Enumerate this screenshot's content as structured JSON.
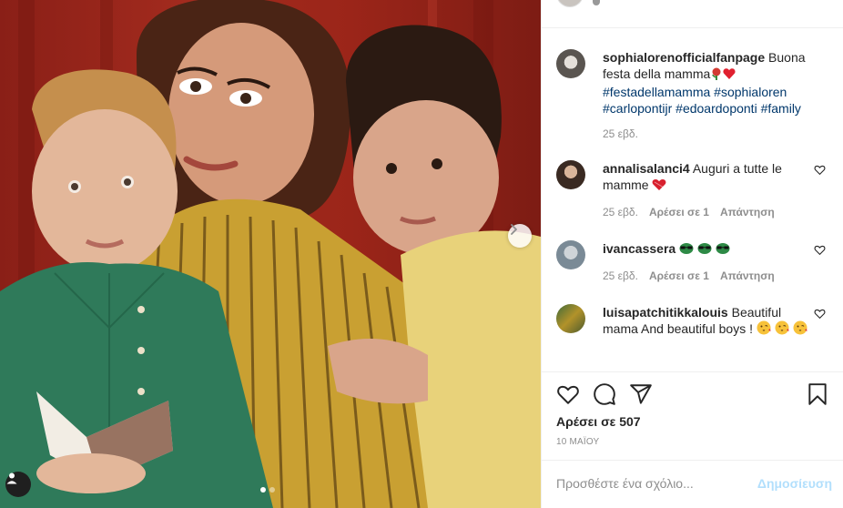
{
  "post": {
    "author": "sophialorenofficialfanpage",
    "caption_text": "Buona festa della mamma",
    "hashtags": [
      "#festadellamamma",
      "#sophialoren",
      "#carloponti jr",
      "#edoardoponti",
      "#family"
    ],
    "caption_time": "25 εβδ."
  },
  "hashtags_display": {
    "h1": "#festadellamamma",
    "h2": "#sophialoren",
    "h3": "#carlopontijr",
    "h4": "#edoardoponti",
    "h5": "#family"
  },
  "comments": [
    {
      "user": "annalisalanci4",
      "text": "Auguri a tutte le mamme",
      "time": "25 εβδ.",
      "likes": "Αρέσει σε 1",
      "reply": "Απάντηση"
    },
    {
      "user": "ivancassera",
      "text": "",
      "time": "25 εβδ.",
      "likes": "Αρέσει σε 1",
      "reply": "Απάντηση"
    },
    {
      "user": "luisapatchitikkalouis",
      "text": "Beautiful mama And beautiful boys !",
      "time": "",
      "likes": "",
      "reply": ""
    }
  ],
  "likes_label": "Αρέσει σε 507",
  "date_label": "10 ΜΑΪΟΥ",
  "add_comment_placeholder": "Προσθέστε ένα σχόλιο...",
  "post_button": "Δημοσίευση",
  "carousel": {
    "total": 2,
    "active_index": 0
  },
  "icons": [
    "heart-icon",
    "comment-icon",
    "share-icon",
    "bookmark-icon",
    "next-arrow-icon",
    "user-tag-icon"
  ],
  "colors": {
    "link": "#00376b",
    "muted": "#8e8e8e",
    "post_disabled": "#b2dffc",
    "heart_red": "#ed4956"
  }
}
